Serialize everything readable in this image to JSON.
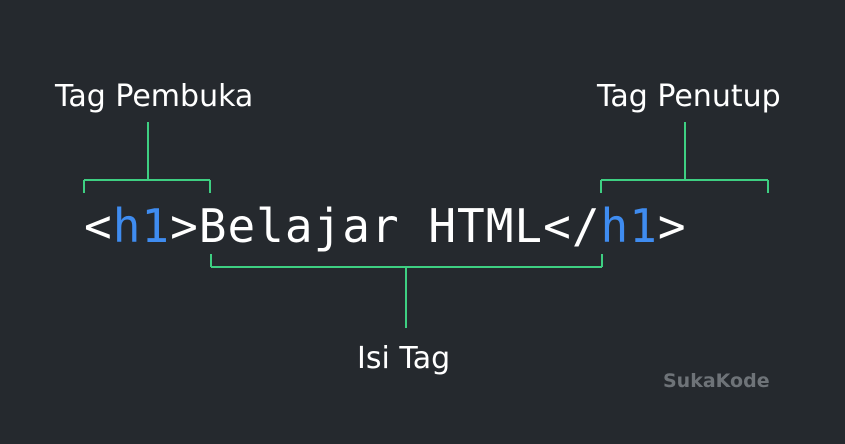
{
  "labels": {
    "opening_tag": "Tag Pembuka",
    "closing_tag": "Tag Penutup",
    "content": "Isi Tag"
  },
  "code": {
    "open_lt": "<",
    "open_name": "h1",
    "open_gt": ">",
    "content": "Belajar HTML",
    "close_lt": "</",
    "close_name": "h1",
    "close_gt": ">"
  },
  "brand": "SukaKode",
  "colors": {
    "background": "#25292e",
    "bracket_line": "#3ecf82",
    "tag_name": "#3f8cf0",
    "text": "#ffffff",
    "brand": "#6e7378"
  }
}
